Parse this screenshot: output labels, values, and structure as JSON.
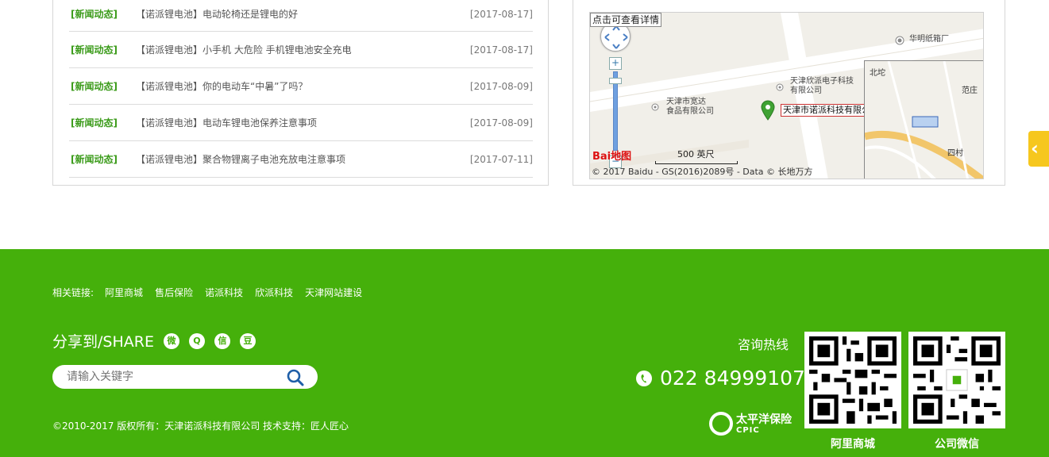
{
  "news": {
    "items": [
      {
        "category": "[新闻动态]",
        "title": "【诺派锂电池】电动轮椅还是锂电的好",
        "date": "[2017-08-17]"
      },
      {
        "category": "[新闻动态]",
        "title": "【诺派锂电池】小手机 大危险 手机锂电池安全充电",
        "date": "[2017-08-17]"
      },
      {
        "category": "[新闻动态]",
        "title": "【诺派锂电池】你的电动车“中暑”了吗？",
        "date": "[2017-08-09]"
      },
      {
        "category": "[新闻动态]",
        "title": "【诺派锂电池】电动车锂电池保养注意事项",
        "date": "[2017-08-09]"
      },
      {
        "category": "[新闻动态]",
        "title": "【诺派锂电池】聚合物锂离子电池充放电注意事项",
        "date": "[2017-07-11]"
      }
    ]
  },
  "map": {
    "hint": "点击可查看详情",
    "company_label": "天津市诺派科技有限公司",
    "poi_1": "华明纸箱厂",
    "poi_2_line1": "天津欣派电子科技",
    "poi_2_line2": "有限公司",
    "poi_3_line1": "天津市宽达",
    "poi_3_line2": "食品有限公司",
    "scale": "500 英尺",
    "baidu_logo": "Bai地图",
    "copyright": "© 2017 Baidu - GS(2016)2089号 - Data © 长地万方",
    "overview_labels": {
      "north": "北坨",
      "east": "范庄",
      "village": "四村"
    },
    "zoom_in": "+",
    "zoom_out": "−"
  },
  "footer": {
    "links_label": "相关链接:",
    "links": [
      "阿里商城",
      "售后保险",
      "诺派科技",
      "欣派科技",
      "天津网站建设"
    ],
    "share_label": "分享到/SHARE",
    "share_icons": [
      "weibo-icon",
      "qq-icon",
      "wechat-icon",
      "douban-icon"
    ],
    "share_glyphs": [
      "微",
      "Q",
      "信",
      "豆"
    ],
    "search_placeholder": "请输入关键字",
    "copyright": "©2010-2017 版权所有：天津诺派科技有限公司   技术支持：匠人匠心",
    "hotline_label": "咨询热线",
    "phone": "022 84999107",
    "insurance_name": "太平洋保险",
    "insurance_sub": "CPIC",
    "qr_captions": [
      "阿里商城",
      "公司微信"
    ]
  },
  "side_tab": {
    "glyph": "‹"
  },
  "colors": {
    "footer_green": "#45b00b",
    "news_category": "#3b9b1a",
    "side_tab": "#f6c71e"
  }
}
